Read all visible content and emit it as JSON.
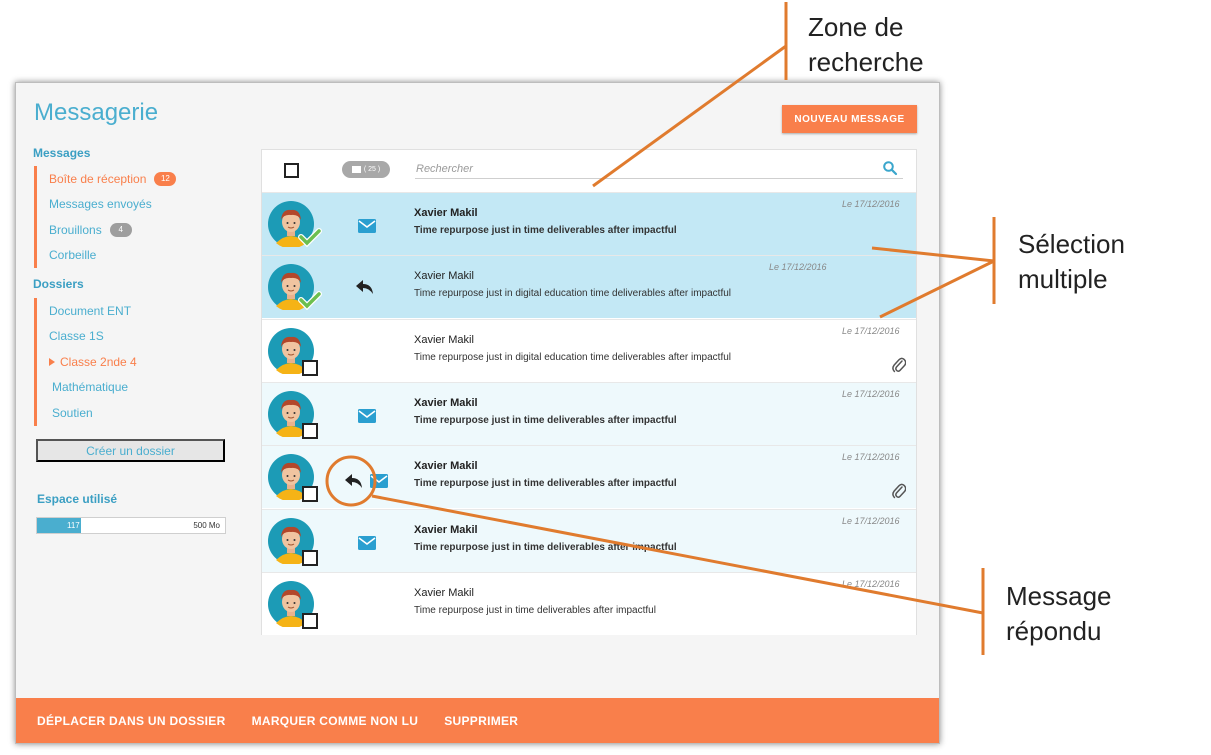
{
  "app": {
    "title": "Messagerie",
    "new_message_button": "NOUVEAU MESSAGE"
  },
  "sidebar": {
    "messages_heading": "Messages",
    "messages": [
      {
        "label": "Boîte de réception",
        "badge": "12",
        "active": true
      },
      {
        "label": "Messages envoyés",
        "badge": ""
      },
      {
        "label": "Brouillons",
        "badge": "4"
      },
      {
        "label": "Corbeille",
        "badge": ""
      }
    ],
    "folders_heading": "Dossiers",
    "folders": [
      {
        "label": "Document ENT"
      },
      {
        "label": "Classe 1S"
      },
      {
        "label": "Classe 2nde 4",
        "active": true,
        "expanded": true
      },
      {
        "label": "Mathématique"
      },
      {
        "label": "Soutien"
      }
    ],
    "create_folder_button": "Créer un dossier",
    "storage": {
      "label": "Espace utilisé",
      "used": "117 Mo",
      "total": "500 Mo",
      "used_fraction": 0.234
    }
  },
  "list": {
    "count_badge": "( 25 )",
    "search_placeholder": "Rechercher",
    "messages": [
      {
        "sender": "Xavier Makil",
        "subject": "Time repurpose just in time deliverables after impactful",
        "date": "Le 17/12/2016",
        "state": "selected",
        "icon": "envelope-icon",
        "attachment": false
      },
      {
        "sender": "Xavier Makil",
        "subject": "Time repurpose just in digital education time deliverables after impactful",
        "date": "Le 17/12/2016",
        "state": "selected",
        "icon": "reply-icon",
        "attachment": false
      },
      {
        "sender": "Xavier Makil",
        "subject": "Time repurpose just in digital education time deliverables after impactful",
        "date": "Le 17/12/2016",
        "state": "read",
        "icon": "",
        "attachment": true
      },
      {
        "sender": "Xavier Makil",
        "subject": "Time repurpose just in time deliverables after impactful",
        "date": "Le 17/12/2016",
        "state": "unread",
        "icon": "envelope-icon",
        "attachment": false
      },
      {
        "sender": "Xavier Makil",
        "subject": "Time repurpose just in time deliverables after impactful",
        "date": "Le 17/12/2016",
        "state": "unread",
        "icon": "reply-and-envelope-icon",
        "attachment": true
      },
      {
        "sender": "Xavier Makil",
        "subject": "Time repurpose just in time deliverables after impactful",
        "date": "Le 17/12/2016",
        "state": "unread",
        "icon": "envelope-icon",
        "attachment": false
      },
      {
        "sender": "Xavier Makil",
        "subject": "Time repurpose just in time deliverables after impactful",
        "date": "Le 17/12/2016",
        "state": "read",
        "icon": "",
        "attachment": false
      }
    ]
  },
  "actions": [
    "DÉPLACER DANS UN DOSSIER",
    "MARQUER COMME NON LU",
    "SUPPRIMER"
  ],
  "annotations": {
    "search": [
      "Zone de",
      "recherche"
    ],
    "multi_select": [
      "Sélection",
      "multiple"
    ],
    "replied": [
      "Message",
      "répondu"
    ]
  },
  "colors": {
    "accent": "#f97f4b",
    "primary": "#4aaecf",
    "selected_row": "#c3e8f5",
    "unread_row": "#eef9fc",
    "annotation": "#e07b2e"
  }
}
